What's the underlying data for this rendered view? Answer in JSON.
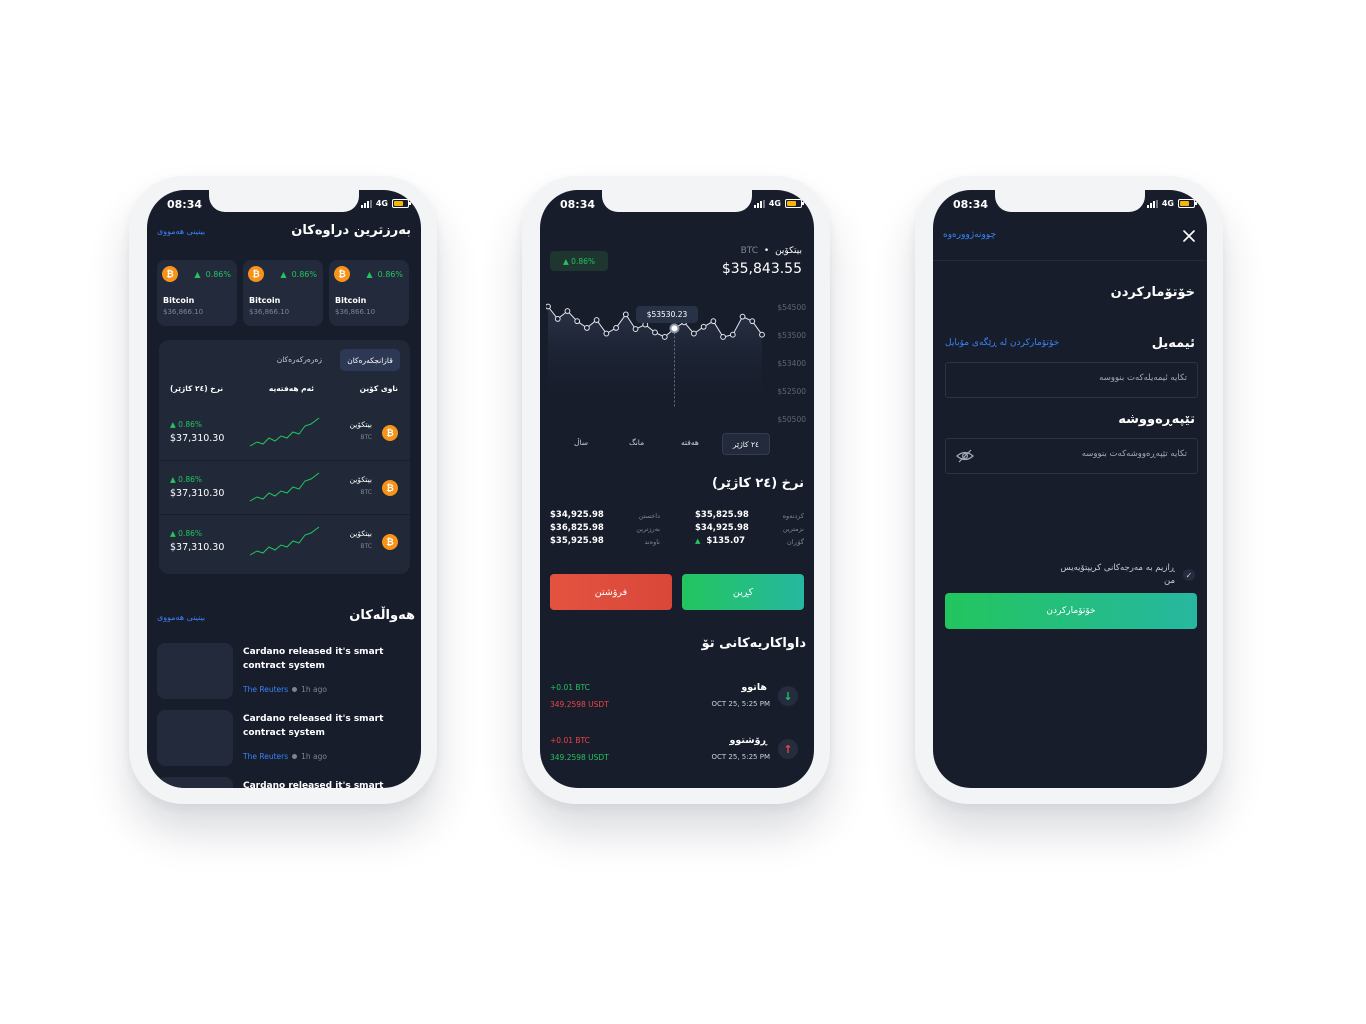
{
  "status": {
    "time": "08:34",
    "network": "4G"
  },
  "screen1": {
    "top_title": "بەرزترین دراوەکان",
    "see_all": "بینینی هەمووی",
    "cards": [
      {
        "name": "Bitcoin",
        "price": "$36,866.10",
        "change": "0.86%"
      },
      {
        "name": "Bitcoin",
        "price": "$36,866.10",
        "change": "0.86%"
      },
      {
        "name": "Bitcoin",
        "price": "$36,866.10",
        "change": "0.86%"
      }
    ],
    "tabs": [
      "قازانجکەرەکان",
      "زەرەرکەرەکان"
    ],
    "table_headers": [
      "ناوی کۆین",
      "ئەم هەفتەیە",
      "نرخ (٢٤ کاژێر)"
    ],
    "rows": [
      {
        "name": "بیتکۆین",
        "symbol": "BTC",
        "change": "0.86%",
        "price": "$37,310.30"
      },
      {
        "name": "بیتکۆین",
        "symbol": "BTC",
        "change": "0.86%",
        "price": "$37,310.30"
      },
      {
        "name": "بیتکۆین",
        "symbol": "BTC",
        "change": "0.86%",
        "price": "$37,310.30"
      }
    ],
    "news_title": "هەواڵەکان",
    "news_see_all": "بینینی هەمووی",
    "news": [
      {
        "title": "Cardano released it's smart contract system",
        "source": "The Reuters",
        "time": "1h ago"
      },
      {
        "title": "Cardano released it's smart contract system",
        "source": "The Reuters",
        "time": "1h ago"
      },
      {
        "title": "Cardano released it's smart",
        "source": "",
        "time": ""
      }
    ]
  },
  "screen2": {
    "coin_name": "بیتکۆین",
    "coin_symbol": "BTC",
    "price": "$35,843.55",
    "change": "0.86%",
    "tooltip": "$53530.23",
    "periods": [
      "٢٤ کاژێر",
      "هەفتە",
      "مانگ",
      "ساڵ"
    ],
    "rate_title": "نرخ (٢٤ کاژێر)",
    "stats_right": [
      {
        "label": "کردنەوە",
        "value": "$35,825.98"
      },
      {
        "label": "نزمترین",
        "value": "$34,925.98"
      },
      {
        "label": "گۆڕان",
        "value": "$135.07"
      }
    ],
    "stats_left": [
      {
        "label": "داخستن",
        "value": "$34,925.98"
      },
      {
        "label": "بەرزترین",
        "value": "$36,825.98"
      },
      {
        "label": "ناوەند",
        "value": "$35,925.98"
      }
    ],
    "buy_label": "کڕین",
    "sell_label": "فرۆشتن",
    "activity_title": "داواکاریەکانی تۆ",
    "activities": [
      {
        "title": "هاتوو",
        "date": "OCT 25, 5:25 PM",
        "amount": "+0.01 BTC",
        "usdt": "349.2598 USDT",
        "direction": "down"
      },
      {
        "title": "ڕۆشتوو",
        "date": "OCT 25, 5:25 PM",
        "amount": "+0.01 BTC",
        "usdt": "349.2598 USDT",
        "direction": "up"
      }
    ],
    "colors": {
      "green": "#22c55e",
      "red": "#e4533f",
      "teal": "#27b7a0"
    }
  },
  "chart_data": {
    "type": "line",
    "title": "",
    "xlabel": "",
    "ylabel": "",
    "y_ticks": [
      "$54500",
      "$53500",
      "$53400",
      "$52500",
      "$50500"
    ],
    "series": [
      {
        "values": [
          54500,
          53950,
          54300,
          53850,
          53550,
          53900,
          53300,
          53550,
          54150,
          53500,
          53700,
          53350,
          53150,
          53530,
          53800,
          53300,
          53600,
          53850,
          53150,
          53250,
          54050,
          53850,
          53250
        ]
      }
    ],
    "ylim": [
      50000,
      54700
    ],
    "highlight_index": 13,
    "grid": false
  },
  "screen3": {
    "close_icon": "close-icon",
    "forgot": "چوونەژوورەوە",
    "title": "خۆتۆمارکردن",
    "email_label": "ئیمەیل",
    "mobile_link": "خۆتۆمارکردن لە ڕێگەی مۆبایل",
    "email_placeholder": "تکایە ئیمەیلەکەت بنووسە",
    "password_label": "تێپەڕەووشە",
    "password_placeholder": "تکایە تێپەڕەووشەکەت بنووسە",
    "terms_line1": "ڕازیم بە مەرجەکانی کریپتۆیەیس",
    "terms_line2": "من",
    "register_button": "خۆتۆمارکردن"
  }
}
